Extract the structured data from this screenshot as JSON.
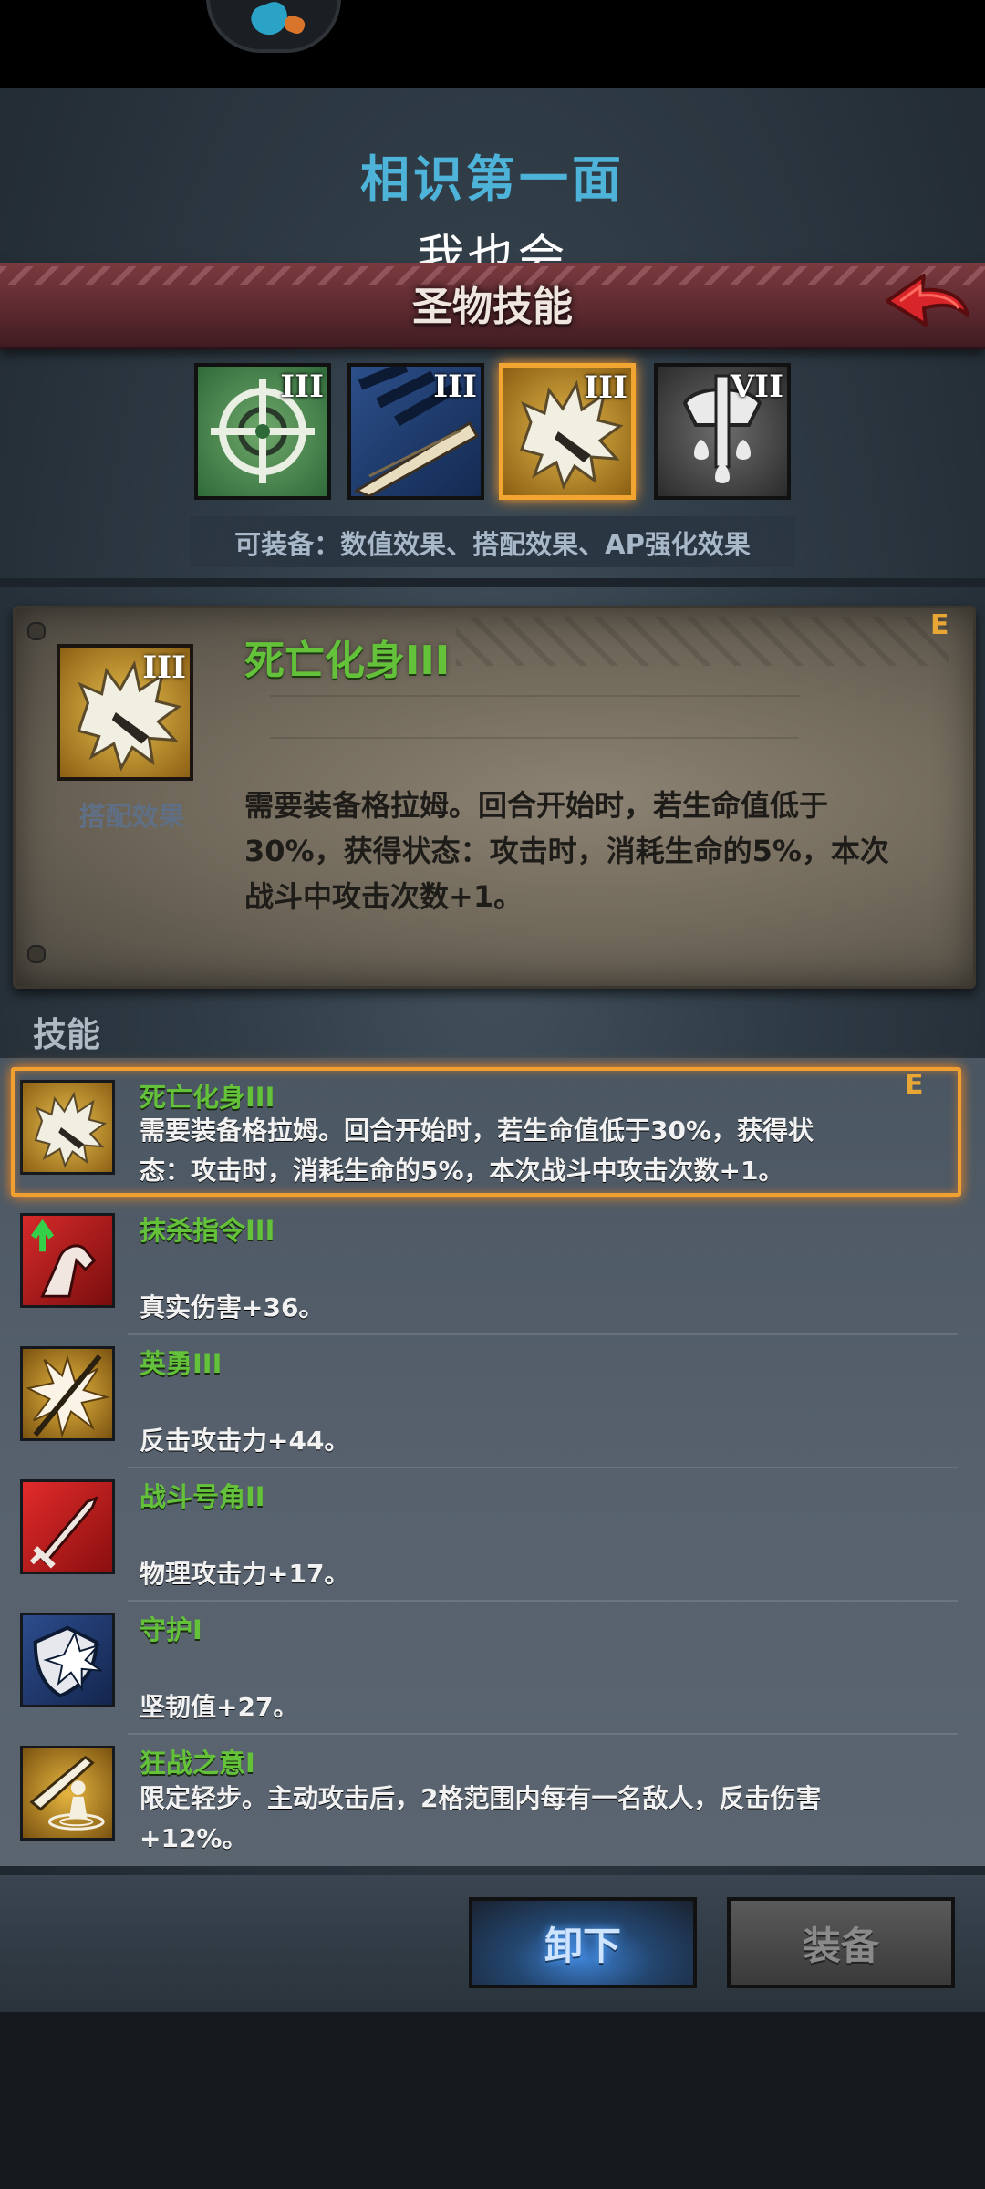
{
  "header": {
    "title": "相识第一面",
    "subtitle": "我也会",
    "section_title": "圣物技能"
  },
  "relics": [
    {
      "icon": "crosshair-icon",
      "rank": "III",
      "selected": false
    },
    {
      "icon": "blue-claw-icon",
      "rank": "III",
      "selected": false
    },
    {
      "icon": "fur-beast-icon",
      "rank": "III",
      "selected": true
    },
    {
      "icon": "axe-drop-icon",
      "rank": "VII",
      "selected": false
    }
  ],
  "equip_hint": "可装备：数值效果、搭配效果、AP强化效果",
  "detail_card": {
    "rank": "III",
    "type_label": "搭配效果",
    "title": "死亡化身III",
    "grade": "E",
    "description": "需要装备格拉姆。回合开始时，若生命值低于30%，获得状态：攻击时，消耗生命的5%，本次战斗中攻击次数+1。"
  },
  "skills_heading": "技能",
  "skills": [
    {
      "name": "死亡化身III",
      "grade": "E",
      "description": "需要装备格拉姆。回合开始时，若生命值低于30%，获得状态：攻击时，消耗生命的5%，本次战斗中攻击次数+1。",
      "icon": "fur-beast-icon",
      "selected": true
    },
    {
      "name": "抹杀指令III",
      "description": "真实伤害+36。",
      "icon": "red-arm-up-icon"
    },
    {
      "name": "英勇III",
      "description": "反击攻击力+44。",
      "icon": "burst-spear-icon"
    },
    {
      "name": "战斗号角II",
      "description": "物理攻击力+17。",
      "icon": "red-sword-icon"
    },
    {
      "name": "守护I",
      "description": "坚韧值+27。",
      "icon": "shield-burst-icon"
    },
    {
      "name": "狂战之意I",
      "description": "限定轻步。主动攻击后，2格范围内每有一名敌人，反击伤害+12%。",
      "icon": "berserk-icon"
    }
  ],
  "buttons": {
    "unequip": "卸下",
    "equip": "装备"
  },
  "colors": {
    "title_blue": "#4eb3d8",
    "skill_green": "#63c23a",
    "grade_orange": "#e8a634",
    "selected_glow": "#f0a030"
  }
}
